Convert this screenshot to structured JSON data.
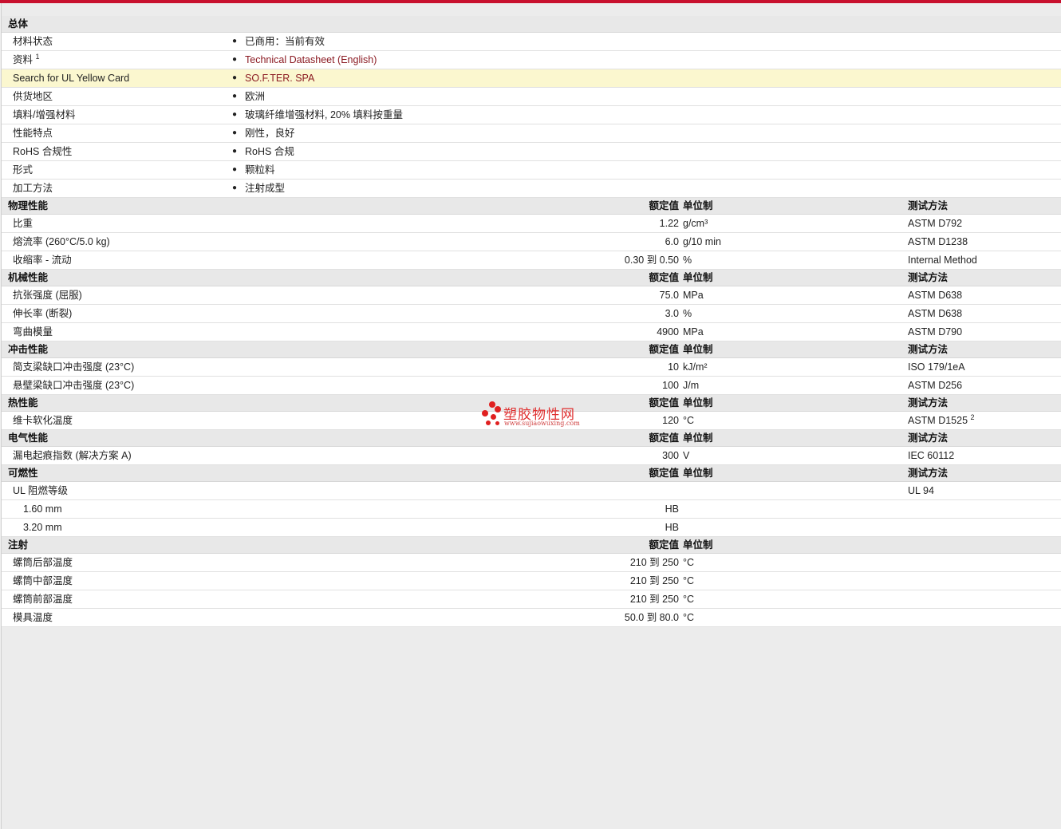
{
  "general": {
    "title": "总体",
    "rows": [
      {
        "label": "材料状态",
        "value": "已商用：当前有效"
      },
      {
        "label": "资料",
        "sup": "1",
        "value": "Technical Datasheet (English)"
      },
      {
        "label": "Search for UL Yellow Card",
        "value": "SO.F.TER. SPA"
      },
      {
        "label": "供货地区",
        "value": "欧洲"
      },
      {
        "label": "填料/增强材料",
        "value": "玻璃纤维增强材料, 20% 填料按重量"
      },
      {
        "label": "性能特点",
        "value": "刚性，良好"
      },
      {
        "label": "RoHS 合规性",
        "value": "RoHS 合规"
      },
      {
        "label": "形式",
        "value": "颗粒料"
      },
      {
        "label": "加工方法",
        "value": "注射成型"
      }
    ]
  },
  "headers": {
    "nominal": "额定值",
    "unit": "单位制",
    "method": "测试方法"
  },
  "sections": [
    {
      "title": "物理性能",
      "rows": [
        {
          "label": "比重",
          "nominal": "1.22",
          "unit": "g/cm³",
          "method": "ASTM D792"
        },
        {
          "label": "熔流率  (260°C/5.0 kg)",
          "nominal": "6.0",
          "unit": "g/10 min",
          "method": "ASTM D1238"
        },
        {
          "label": "收缩率  - 流动",
          "nominal": "0.30  到  0.50",
          "unit": "%",
          "method": "Internal Method"
        }
      ]
    },
    {
      "title": "机械性能",
      "rows": [
        {
          "label": "抗张强度  (屈服)",
          "nominal": "75.0",
          "unit": "MPa",
          "method": "ASTM D638"
        },
        {
          "label": "伸长率  (断裂)",
          "nominal": "3.0",
          "unit": "%",
          "method": "ASTM D638"
        },
        {
          "label": "弯曲模量",
          "nominal": "4900",
          "unit": "MPa",
          "method": "ASTM D790"
        }
      ]
    },
    {
      "title": "冲击性能",
      "rows": [
        {
          "label": "简支梁缺口冲击强度  (23°C)",
          "nominal": "10",
          "unit": "kJ/m²",
          "method": "ISO 179/1eA"
        },
        {
          "label": "悬壁梁缺口冲击强度  (23°C)",
          "nominal": "100",
          "unit": "J/m",
          "method": "ASTM D256"
        }
      ]
    },
    {
      "title": "热性能",
      "rows": [
        {
          "label": "维卡软化温度",
          "nominal": "120",
          "unit": "°C",
          "method": "ASTM D1525",
          "sup": "2"
        }
      ]
    },
    {
      "title": "电气性能",
      "rows": [
        {
          "label": "漏电起痕指数  (解决方案  A)",
          "nominal": "300",
          "unit": "V",
          "method": "IEC 60112"
        }
      ]
    },
    {
      "title": "可燃性",
      "rows": [
        {
          "label": "UL 阻燃等级",
          "nominal": "",
          "unit": "",
          "method": "UL 94"
        },
        {
          "label": "1.60 mm",
          "indent": true,
          "nominal": "HB",
          "unit": "",
          "method": ""
        },
        {
          "label": "3.20 mm",
          "indent": true,
          "nominal": "HB",
          "unit": "",
          "method": ""
        }
      ]
    },
    {
      "title": "注射",
      "no_method": true,
      "rows": [
        {
          "label": "螺筒后部温度",
          "nominal": "210  到  250",
          "unit": "°C",
          "method": ""
        },
        {
          "label": "螺筒中部温度",
          "nominal": "210  到  250",
          "unit": "°C",
          "method": ""
        },
        {
          "label": "螺筒前部温度",
          "nominal": "210  到  250",
          "unit": "°C",
          "method": ""
        },
        {
          "label": "模具温度",
          "nominal": "50.0  到  80.0",
          "unit": "°C",
          "method": ""
        }
      ]
    }
  ],
  "watermark": {
    "cn": "塑胶物性网",
    "url": "www.sujiaowuxing.com"
  },
  "colors": {
    "accent": "#c8102e",
    "link": "#8b1a22",
    "highlight": "#fbf7cf"
  }
}
